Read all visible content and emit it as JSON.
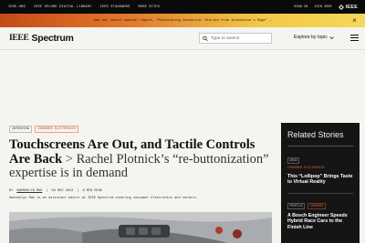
{
  "topbar": {
    "links": [
      "IEEE.ORG",
      "IEEE XPLORE DIGITAL LIBRARY",
      "IEEE STANDARDS",
      "MORE SITES"
    ],
    "sign_in": "SIGN IN",
    "join": "JOIN IEEE",
    "logo_text": "IEEE"
  },
  "promo": {
    "text": "See our latest special report, “Reinventing Invention: Stories from Innovation’s Edge” →",
    "close_icon": "close-icon"
  },
  "header": {
    "brand_ieee": "IEEE",
    "brand_name": "Spectrum",
    "search_placeholder": "Type to search",
    "explore_label": "Explore by topic"
  },
  "article": {
    "tags": [
      "INTERVIEW",
      "CONSUMER ELECTRONICS"
    ],
    "headline_main": "Touchscreens Are Out, and Tactile Controls Are Back",
    "headline_sep": ">",
    "headline_dek": "Rachel Plotnick’s “re-buttonization” expertise is in demand",
    "byline_prefix": "BY",
    "author": "GWENDOLYN RAK",
    "date": "03 NOV 2024",
    "read_time": "6 MIN READ",
    "bio": "Gwendolyn Rak is an assistant editor at IEEE Spectrum covering consumer electronics and careers."
  },
  "sidebar": {
    "title": "Related Stories",
    "stories": [
      {
        "kickers": [
          "NEWS"
        ],
        "category": "CONSUMER ELECTRONICS",
        "headline": "This “Lollipop” Brings Taste to Virtual Reality"
      },
      {
        "kickers": [
          "PROFILE",
          "CAREERS"
        ],
        "category": "",
        "headline": "A Bosch Engineer Speeds Hybrid Race Cars to the Finish Line"
      }
    ]
  },
  "colors": {
    "accent": "#d04a1d",
    "topbar_bg": "#0a0a0a",
    "sidebar_bg": "#151515",
    "page_bg": "#f4f4f1"
  }
}
